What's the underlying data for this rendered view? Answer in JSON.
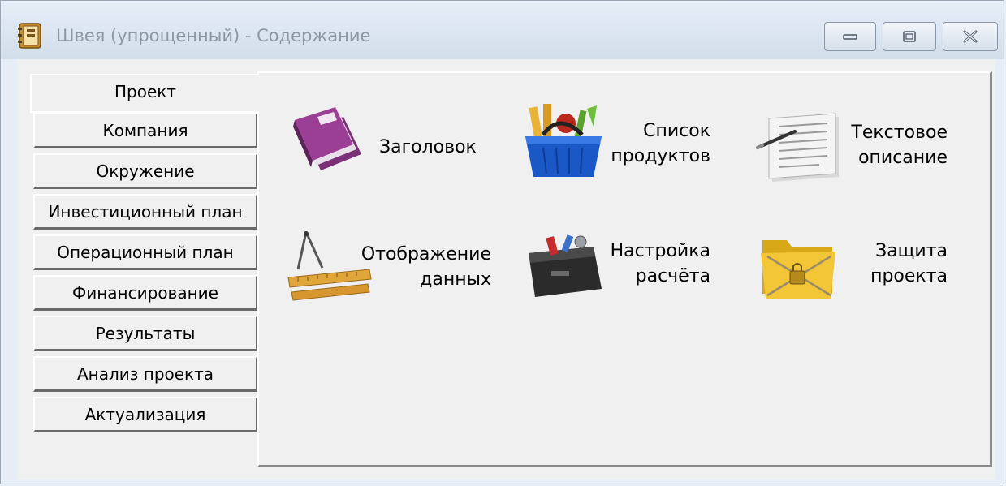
{
  "window": {
    "title": "Швея (упрощенный) - Содержание",
    "icon": "notebook-icon"
  },
  "titlebar_buttons": {
    "minimize": "minimize-icon",
    "maximize": "maximize-icon",
    "close": "close-icon"
  },
  "nav": [
    {
      "label": "Проект",
      "active": true
    },
    {
      "label": "Компания",
      "active": false
    },
    {
      "label": "Окружение",
      "active": false
    },
    {
      "label": "Инвестиционный план",
      "active": false
    },
    {
      "label": "Операционный план",
      "active": false
    },
    {
      "label": "Финансирование",
      "active": false
    },
    {
      "label": "Результаты",
      "active": false
    },
    {
      "label": "Анализ проекта",
      "active": false
    },
    {
      "label": "Актуализация",
      "active": false
    }
  ],
  "tiles": [
    {
      "lines": [
        "Заголовок"
      ],
      "icon": "purple-books-icon"
    },
    {
      "lines": [
        "Список",
        "продуктов"
      ],
      "icon": "shopping-basket-icon"
    },
    {
      "lines": [
        "Текстовое",
        "описание"
      ],
      "icon": "document-pen-icon"
    },
    {
      "lines": [
        "Отображение",
        "данных"
      ],
      "icon": "compass-ruler-icon"
    },
    {
      "lines": [
        "Настройка",
        "расчёта"
      ],
      "icon": "toolbox-icon"
    },
    {
      "lines": [
        "Защита",
        "проекта"
      ],
      "icon": "locked-folder-icon"
    }
  ],
  "colors": {
    "title_text": "#8c97a3",
    "panel_bg": "#f0f0f0",
    "folder_yellow": "#f2c636",
    "book_purple": "#9b3f95"
  }
}
